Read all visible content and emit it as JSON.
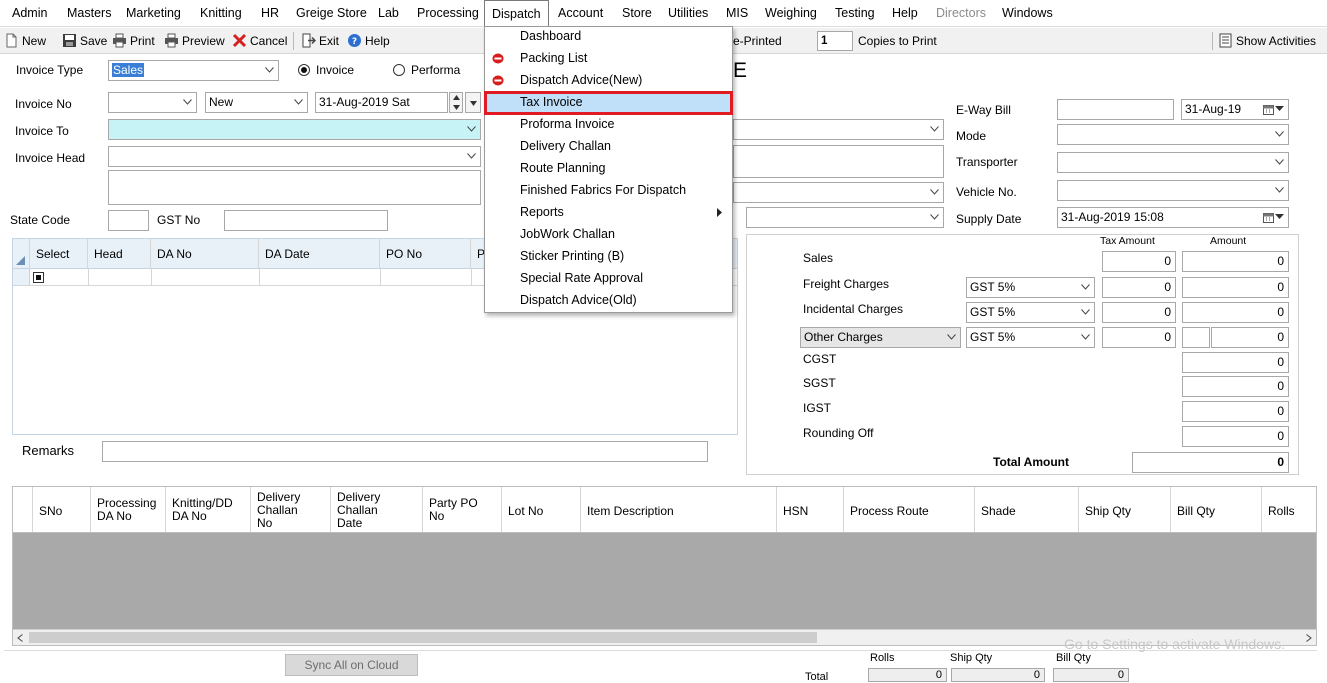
{
  "menubar": {
    "items": [
      {
        "label": "Admin"
      },
      {
        "label": "Masters"
      },
      {
        "label": "Marketing"
      },
      {
        "label": "Knitting"
      },
      {
        "label": "HR"
      },
      {
        "label": "Greige Store"
      },
      {
        "label": "Lab"
      },
      {
        "label": "Processing"
      },
      {
        "label": "Dispatch"
      },
      {
        "label": "Account"
      },
      {
        "label": "Store"
      },
      {
        "label": "Utilities"
      },
      {
        "label": "MIS"
      },
      {
        "label": "Weighing"
      },
      {
        "label": "Testing"
      },
      {
        "label": "Help"
      },
      {
        "label": "Directors"
      },
      {
        "label": "Windows"
      }
    ]
  },
  "toolbar": {
    "new_label": "New",
    "save_label": "Save",
    "print_label": "Print",
    "preview_label": "Preview",
    "cancel_label": "Cancel",
    "exit_label": "Exit",
    "help_label": "Help",
    "reprinted_label": "e-Printed",
    "copies_value": "1",
    "copies_label": "Copies to Print",
    "activities_label": "Show Activities"
  },
  "dispatch_menu": {
    "items": [
      {
        "label": "Dashboard",
        "icon": ""
      },
      {
        "label": "Packing List",
        "icon": "red-stop-icon"
      },
      {
        "label": "Dispatch Advice(New)",
        "icon": "red-stop-icon"
      },
      {
        "label": "Tax Invoice",
        "icon": "",
        "highlighted": true
      },
      {
        "label": "Proforma Invoice",
        "icon": ""
      },
      {
        "label": "Delivery Challan",
        "icon": ""
      },
      {
        "label": "Route Planning",
        "icon": ""
      },
      {
        "label": "Finished Fabrics For Dispatch",
        "icon": ""
      },
      {
        "label": "Reports",
        "icon": "",
        "submenu": true
      },
      {
        "label": "JobWork Challan",
        "icon": ""
      },
      {
        "label": "Sticker Printing (B)",
        "icon": ""
      },
      {
        "label": "Special Rate Approval",
        "icon": ""
      },
      {
        "label": "Dispatch Advice(Old)",
        "icon": ""
      }
    ]
  },
  "form": {
    "invoice_type_label": "Invoice Type",
    "invoice_type_value": "Sales",
    "radio_invoice": "Invoice",
    "radio_performa": "Performa",
    "title_fragment": "E",
    "invoice_no_label": "Invoice No",
    "invoice_no_value": "",
    "status_value": "New",
    "date_value": "31-Aug-2019  Sat",
    "invoice_to_label": "Invoice To",
    "invoice_head_label": "Invoice Head",
    "state_code_label": "State Code",
    "gst_no_label": "GST No",
    "remarks_label": "Remarks"
  },
  "right_panel": {
    "eway_label": "E-Way Bill",
    "eway_date": "31-Aug-19",
    "mode_label": "Mode",
    "transporter_label": "Transporter",
    "vehicle_label": "Vehicle No.",
    "supply_label": "Supply Date",
    "supply_value": "31-Aug-2019 15:08"
  },
  "select_grid": {
    "columns": [
      "Select",
      "Head",
      "DA No",
      "DA Date",
      "PO No",
      "P"
    ]
  },
  "charges": {
    "tax_amount_header": "Tax Amount",
    "amount_header": "Amount",
    "sales_label": "Sales",
    "sales_tax": "0",
    "sales_amount": "0",
    "freight_label": "Freight Charges",
    "freight_gst": "GST 5%",
    "freight_tax": "0",
    "freight_amount": "0",
    "incidental_label": "Incidental Charges",
    "incidental_gst": "GST 5%",
    "incidental_tax": "0",
    "incidental_amount": "0",
    "other_label": "Other Charges",
    "other_gst": "GST 5%",
    "other_tax": "0",
    "other_amount": "0",
    "cgst_label": "CGST",
    "cgst_amount": "0",
    "sgst_label": "SGST",
    "sgst_amount": "0",
    "igst_label": "IGST",
    "igst_amount": "0",
    "rounding_label": "Rounding Off",
    "rounding_amount": "0",
    "total_label": "Total Amount",
    "total_amount": "0"
  },
  "items_grid": {
    "columns": [
      {
        "label": "SNo"
      },
      {
        "label": "Processing\nDA No"
      },
      {
        "label": "Knitting/DD\nDA No"
      },
      {
        "label": "Delivery\nChallan\nNo"
      },
      {
        "label": "Delivery\nChallan\nDate"
      },
      {
        "label": "Party PO\nNo"
      },
      {
        "label": "Lot No"
      },
      {
        "label": "Item Description"
      },
      {
        "label": "HSN"
      },
      {
        "label": "Process Route"
      },
      {
        "label": "Shade"
      },
      {
        "label": "Ship Qty"
      },
      {
        "label": "Bill Qty"
      },
      {
        "label": "Rolls"
      }
    ]
  },
  "footer": {
    "sync_label": "Sync All on Cloud",
    "rolls_label": "Rolls",
    "shipqty_label": "Ship Qty",
    "billqty_label": "Bill Qty",
    "total_label": "Total",
    "rolls_total": "0",
    "shipqty_total": "0",
    "billqty_total": "0",
    "watermark": "Go to Settings to activate Windows."
  }
}
